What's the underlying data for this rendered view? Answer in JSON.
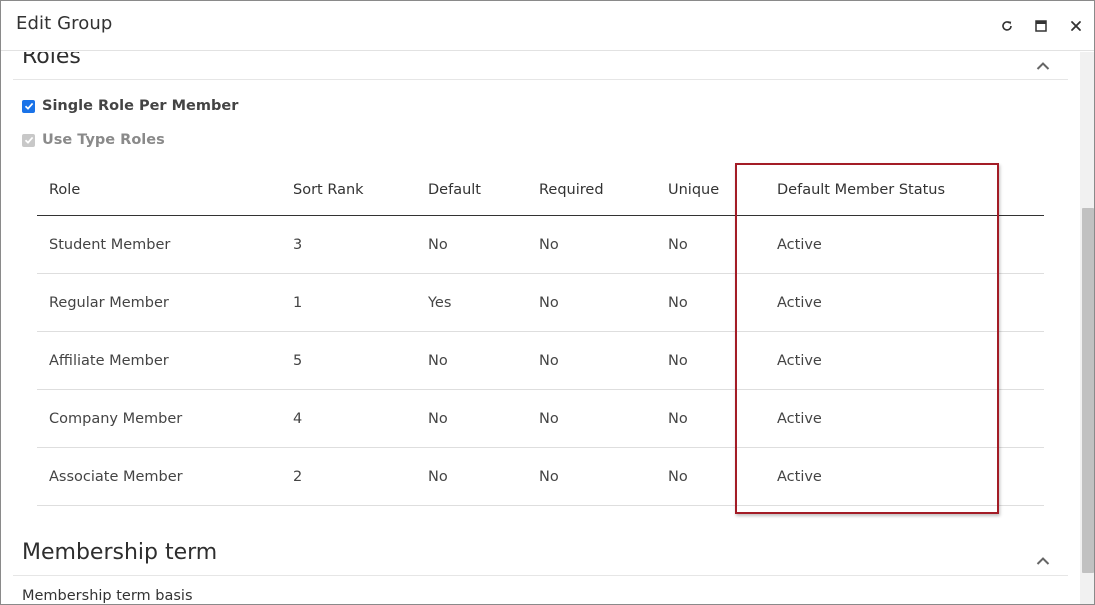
{
  "dialog": {
    "title": "Edit Group"
  },
  "roles_section": {
    "title": "Roles",
    "single_role_label": "Single Role Per Member",
    "use_type_roles_label": "Use Type Roles",
    "single_role_checked": true,
    "use_type_roles_checked": true,
    "use_type_roles_disabled": true
  },
  "table": {
    "headers": {
      "role": "Role",
      "sort_rank": "Sort Rank",
      "default": "Default",
      "required": "Required",
      "unique": "Unique",
      "status": "Default Member Status"
    },
    "rows": [
      {
        "role": "Student Member",
        "sort_rank": "3",
        "default": "No",
        "required": "No",
        "unique": "No",
        "status": "Active"
      },
      {
        "role": "Regular Member",
        "sort_rank": "1",
        "default": "Yes",
        "required": "No",
        "unique": "No",
        "status": "Active"
      },
      {
        "role": "Affiliate Member",
        "sort_rank": "5",
        "default": "No",
        "required": "No",
        "unique": "No",
        "status": "Active"
      },
      {
        "role": "Company Member",
        "sort_rank": "4",
        "default": "No",
        "required": "No",
        "unique": "No",
        "status": "Active"
      },
      {
        "role": "Associate Member",
        "sort_rank": "2",
        "default": "No",
        "required": "No",
        "unique": "No",
        "status": "Active"
      }
    ]
  },
  "membership_section": {
    "title": "Membership term",
    "basis_label": "Membership term basis"
  },
  "colors": {
    "accent": "#1a73e8",
    "highlight_border": "#a31c26"
  },
  "icons": {
    "refresh": "refresh-icon",
    "maximize": "maximize-icon",
    "close": "close-icon",
    "collapse": "chevron-up-icon",
    "check": "check-icon"
  }
}
